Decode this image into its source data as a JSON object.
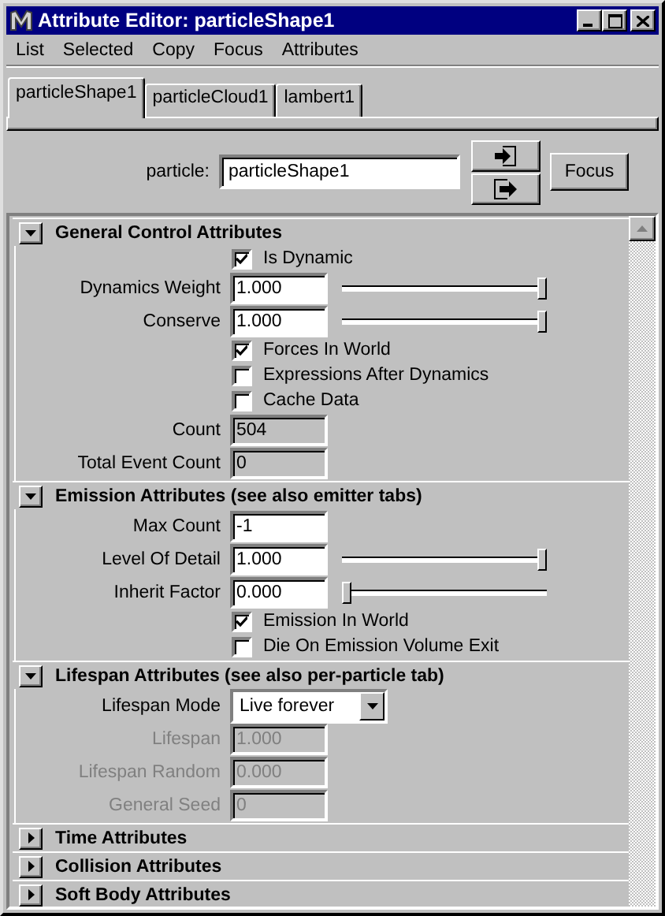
{
  "window": {
    "title": "Attribute Editor: particleShape1"
  },
  "menu": [
    "List",
    "Selected",
    "Copy",
    "Focus",
    "Attributes"
  ],
  "tabs": [
    {
      "label": "particleShape1",
      "selected": true
    },
    {
      "label": "particleCloud1",
      "selected": false
    },
    {
      "label": "lambert1",
      "selected": false
    }
  ],
  "node": {
    "label": "particle:",
    "value": "particleShape1",
    "focus_button": "Focus"
  },
  "sections": [
    {
      "title": "General Control Attributes",
      "expanded": true,
      "rows": [
        {
          "kind": "checkbox",
          "label": "Is Dynamic",
          "checked": true
        },
        {
          "kind": "field",
          "label": "Dynamics Weight",
          "value": "1.000",
          "level": 1
        },
        {
          "kind": "field",
          "label": "Conserve",
          "value": "1.000",
          "level": 1
        },
        {
          "kind": "checkbox",
          "label": "Forces In World",
          "checked": true
        },
        {
          "kind": "checkbox",
          "label": "Expressions After Dynamics",
          "checked": false
        },
        {
          "kind": "checkbox",
          "label": "Cache Data",
          "checked": false
        },
        {
          "kind": "readonly",
          "label": "Count",
          "value": "504"
        },
        {
          "kind": "readonly",
          "label": "Total Event Count",
          "value": "0"
        }
      ]
    },
    {
      "title": "Emission Attributes (see also emitter tabs)",
      "expanded": true,
      "rows": [
        {
          "kind": "field",
          "label": "Max Count",
          "value": "-1"
        },
        {
          "kind": "field",
          "label": "Level Of Detail",
          "value": "1.000",
          "level": 1
        },
        {
          "kind": "field",
          "label": "Inherit Factor",
          "value": "0.000",
          "level": 0
        },
        {
          "kind": "checkbox",
          "label": "Emission In World",
          "checked": true
        },
        {
          "kind": "checkbox",
          "label": "Die On Emission Volume Exit",
          "checked": false
        }
      ]
    },
    {
      "title": "Lifespan Attributes (see also per-particle tab)",
      "expanded": true,
      "rows": [
        {
          "kind": "dropdown",
          "label": "Lifespan Mode",
          "value": "Live forever"
        },
        {
          "kind": "disabled",
          "label": "Lifespan",
          "value": "1.000"
        },
        {
          "kind": "disabled",
          "label": "Lifespan Random",
          "value": "0.000"
        },
        {
          "kind": "disabled",
          "label": "General Seed",
          "value": "0"
        }
      ]
    },
    {
      "title": "Time Attributes",
      "expanded": false
    },
    {
      "title": "Collision Attributes",
      "expanded": false
    },
    {
      "title": "Soft Body Attributes",
      "expanded": false
    }
  ]
}
